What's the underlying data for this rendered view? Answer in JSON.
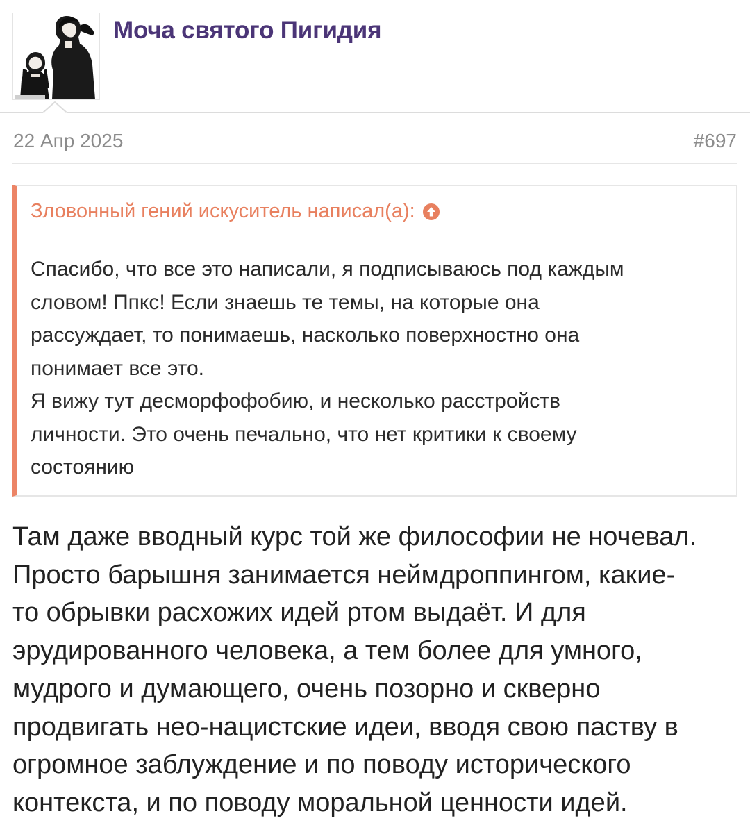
{
  "post": {
    "author": "Моча святого Пигидия",
    "date": "22 Апр 2025",
    "number": "#697"
  },
  "quote": {
    "author_line": "Зловонный гений искуситель написал(а):",
    "jump_icon": "arrow-up-circle-icon",
    "lines": [
      "Спасибо, что все это написали, я подписываюсь под каждым",
      "словом! Ппкс! Если знаешь те темы, на которые она",
      "рассуждает, то понимаешь, насколько поверхностно она",
      "понимает все это.",
      "Я вижу тут десморфофобию, и несколько расстройств",
      "личности. Это очень печально, что нет критики к своему",
      "состоянию"
    ]
  },
  "body": {
    "lines": [
      "Там даже вводный курс той же философии не ночевал.",
      "Просто барышня занимается неймдроппингом, какие-",
      "то обрывки расхожих идей ртом выдаёт. И для",
      "эрудированного человека, а тем более для умного,",
      "мудрого и думающего, очень позорно и скверно",
      "продвигать нео-нацистские идеи, вводя свою паству в",
      "огромное заблуждение и по поводу исторического",
      "контекста, и по поводу моральной ценности идей."
    ]
  },
  "colors": {
    "username": "#4b3577",
    "quote_accent": "#ec8466",
    "meta_text": "#8c8c8c",
    "body_text": "#222222"
  }
}
